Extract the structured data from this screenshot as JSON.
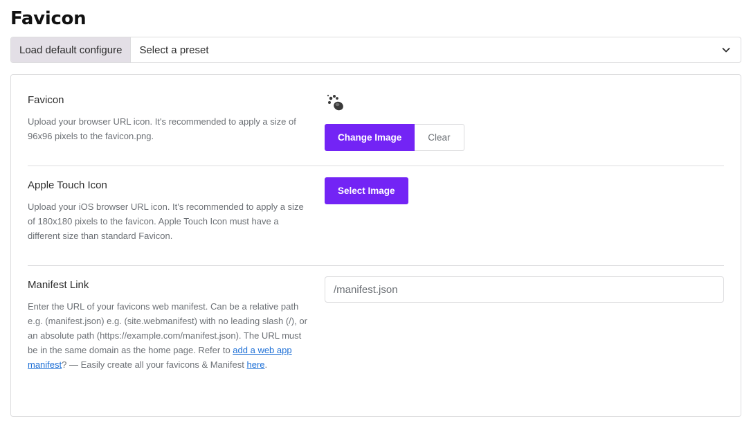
{
  "page": {
    "title": "Favicon"
  },
  "preset": {
    "load_label": "Load default configure",
    "selected": "Select a preset"
  },
  "settings": {
    "favicon": {
      "label": "Favicon",
      "description": "Upload your browser URL icon. It's recommended to apply a size of 96x96 pixels to the favicon.png.",
      "change_button": "Change Image",
      "clear_button": "Clear"
    },
    "apple_touch": {
      "label": "Apple Touch Icon",
      "description": "Upload your iOS browser URL icon. It's recommended to apply a size of 180x180 pixels to the favicon. Apple Touch Icon must have a different size than standard Favicon.",
      "select_button": "Select Image"
    },
    "manifest": {
      "label": "Manifest Link",
      "value": "/manifest.json",
      "description_part1": "Enter the URL of your favicons web manifest. Can be a relative path e.g. (manifest.json) e.g. (site.webmanifest) with no leading slash (/), or an absolute path (https://example.com/manifest.json). The URL must be in the same domain as the home page. Refer to ",
      "link1": "add a web app manifest",
      "description_part2": "? — Easily create all your favicons & Manifest ",
      "link2": "here",
      "description_part3": "."
    }
  },
  "colors": {
    "accent": "#7324f5",
    "link": "#1d6fd6",
    "preset_label_bg": "#e3dfe6",
    "border": "#dcdcde"
  },
  "icons": {
    "favicon_preview": "paw-icon",
    "dropdown": "chevron-down-icon"
  }
}
